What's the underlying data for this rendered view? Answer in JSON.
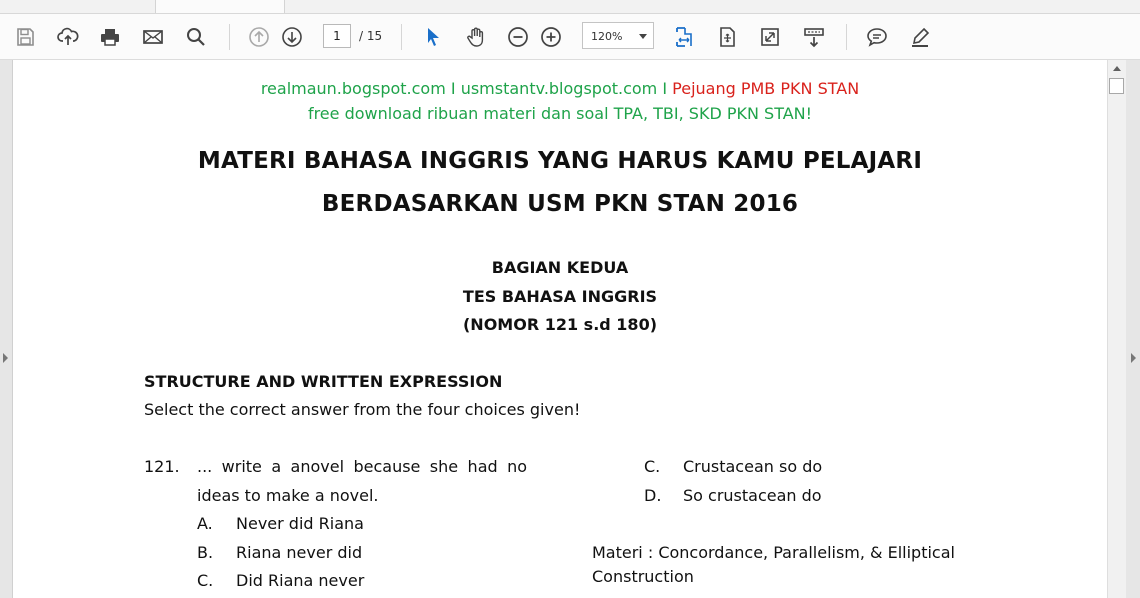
{
  "toolbar": {
    "icons": [
      "save-icon",
      "upload-icon",
      "print-icon",
      "email-icon",
      "search-icon",
      "previous-page-icon",
      "next-page-icon",
      "select-cursor-icon",
      "hand-icon",
      "zoom-out-icon",
      "zoom-in-icon",
      "fit-width-icon",
      "fit-page-icon",
      "full-screen-icon",
      "read-mode-icon",
      "comment-icon",
      "highlight-icon"
    ],
    "page_current": "1",
    "page_total": "/ 15",
    "zoom": "120%",
    "accent": "#1a6fc9"
  },
  "document": {
    "header_line1": "realmaun.bogspot.com I usmstantv.blogspot.com I",
    "header_line1_red": "Pejuang PMB PKN STAN",
    "header_line2": "free download ribuan materi dan soal TPA, TBI, SKD PKN STAN!",
    "title_line1": "MATERI BAHASA INGGRIS YANG HARUS KAMU PELAJARI",
    "title_line2": "BERDASARKAN USM PKN STAN 2016",
    "section1": "BAGIAN KEDUA",
    "section2": "TES BAHASA INGGRIS",
    "section3": "(NOMOR 121 s.d 180)",
    "instruction_heading": "STRUCTURE AND WRITTEN EXPRESSION",
    "instruction_text": "Select the correct answer from the four choices given!",
    "question": {
      "number": "121.",
      "line1": "... write a anovel because she had no",
      "line2": "ideas to make a novel.",
      "options_left": [
        {
          "letter": "A.",
          "text": "Never did Riana"
        },
        {
          "letter": "B.",
          "text": "Riana never did"
        },
        {
          "letter": "C.",
          "text": "Did Riana never"
        }
      ],
      "options_right": [
        {
          "letter": "C.",
          "text": "Crustacean so do"
        },
        {
          "letter": "D.",
          "text": "So crustacean do"
        }
      ],
      "materi_line1": "Materi : Concordance, Parallelism, & Elliptical",
      "materi_line2": "Construction"
    }
  }
}
